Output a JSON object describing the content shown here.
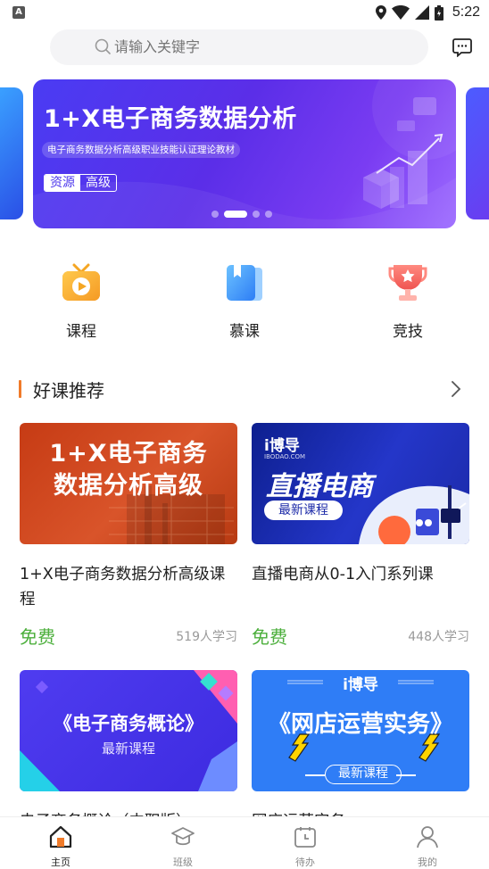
{
  "status_bar": {
    "time": "5:22",
    "app_badge": "A"
  },
  "search": {
    "placeholder": "请输入关键字"
  },
  "banner": {
    "title": "1+X电子商务数据分析",
    "subtitle": "电子商务数据分析高级职业技能认证理论教材",
    "tag_primary": "资源",
    "tag_secondary": "高级",
    "active_dot": 1,
    "dot_count": 4
  },
  "quick_nav": [
    {
      "label": "课程",
      "icon": "tv-play-icon"
    },
    {
      "label": "慕课",
      "icon": "book-icon"
    },
    {
      "label": "竞技",
      "icon": "trophy-icon"
    }
  ],
  "section": {
    "title": "好课推荐"
  },
  "courses": [
    {
      "thumb_line1": "1+X电子商务",
      "thumb_line2": "数据分析高级",
      "title": "1+X电子商务数据分析高级课程",
      "price": "免费",
      "learners": "519人学习"
    },
    {
      "thumb_logo": "i博导",
      "thumb_logo_sub": "IBODAO.COM",
      "thumb_title": "直播电商",
      "thumb_pill": "最新课程",
      "title": "直播电商从0-1入门系列课",
      "price": "免费",
      "learners": "448人学习"
    },
    {
      "thumb_title": "《电子商务概论》",
      "thumb_sub": "最新课程",
      "title": "电子商务概论（中职版）"
    },
    {
      "thumb_logo": "i博导",
      "thumb_title": "《网店运营实务》",
      "thumb_pill": "最新课程",
      "title": "网店运营实务"
    }
  ],
  "tabbar": [
    {
      "label": "主页",
      "icon": "home-icon",
      "active": true
    },
    {
      "label": "班级",
      "icon": "graduation-cap-icon"
    },
    {
      "label": "待办",
      "icon": "calendar-clock-icon"
    },
    {
      "label": "我的",
      "icon": "person-icon"
    }
  ],
  "colors": {
    "accent_orange": "#f07b2a",
    "free_green": "#4caf3c",
    "banner_purple": "#5b2ee8"
  }
}
